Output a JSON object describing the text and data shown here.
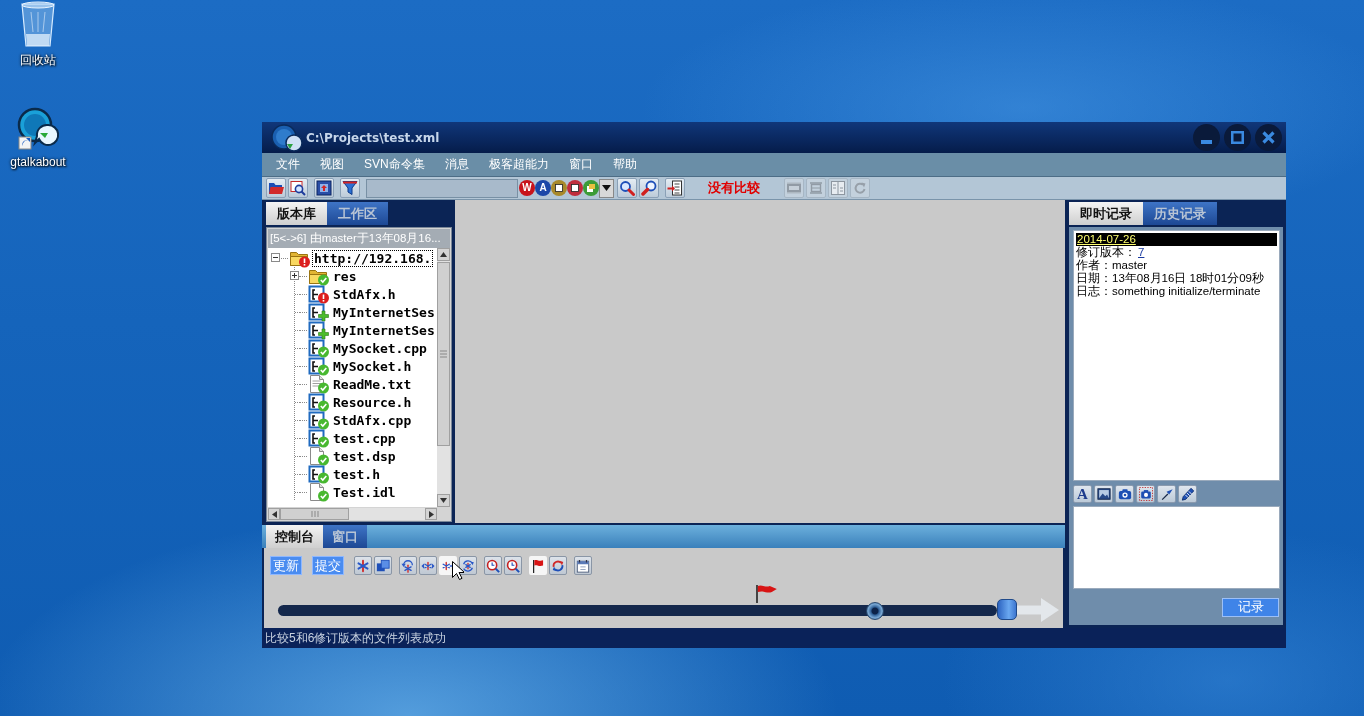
{
  "desktop": {
    "icons": [
      {
        "kind": "recycle-bin",
        "label": "回收站"
      },
      {
        "kind": "shortcut",
        "label": "gtalkabout"
      }
    ]
  },
  "window": {
    "title": "C:\\Projects\\test.xml"
  },
  "menu": [
    "文件",
    "视图",
    "SVN命令集",
    "消息",
    "极客超能力",
    "窗口",
    "帮助"
  ],
  "toolbar": {
    "tool_groups": [
      [
        {
          "kind": "folder",
          "disabled": false
        },
        {
          "kind": "find",
          "disabled": false
        }
      ],
      [
        {
          "kind": "monitor",
          "disabled": false
        }
      ],
      [
        {
          "kind": "funnel",
          "disabled": false
        }
      ]
    ],
    "filter_buttons": [
      {
        "kind": "letter",
        "label": "W",
        "color": "#c8141c"
      },
      {
        "kind": "letter",
        "label": "A",
        "color": "#1c48a8"
      },
      {
        "kind": "square",
        "color": "#a8892a"
      },
      {
        "kind": "square",
        "color": "#c02c3c"
      },
      {
        "kind": "window",
        "color": "#3c9c38"
      }
    ],
    "search_groups": [
      [
        {
          "kind": "zoom",
          "disabled": false
        },
        {
          "kind": "zoom-red",
          "disabled": false
        }
      ],
      [
        {
          "kind": "doc-arrow",
          "disabled": false
        }
      ]
    ],
    "compare_status": "没有比较",
    "compare_tools": [
      {
        "kind": "film",
        "disabled": true
      },
      {
        "kind": "frame",
        "disabled": true
      },
      {
        "kind": "compare",
        "disabled": true
      },
      {
        "kind": "refresh",
        "disabled": true
      }
    ]
  },
  "tree_panel": {
    "tabs": [
      {
        "label": "版本库",
        "selected": true
      },
      {
        "label": "工作区",
        "selected": false
      }
    ],
    "header": "[5<->6] 由master于13年08月16...",
    "root": {
      "label": "http://192.168.",
      "kind": "folder",
      "conflicted": true,
      "added": false,
      "expanded": true,
      "selected": true,
      "children": [
        {
          "label": "res",
          "kind": "folder",
          "conflicted": false,
          "added": false,
          "expanded": false,
          "selected": false
        },
        {
          "label": "StdAfx.h",
          "kind": "code",
          "conflicted": true,
          "added": false,
          "selected": false
        },
        {
          "label": "MyInternetSes",
          "kind": "code",
          "conflicted": false,
          "added": true,
          "selected": false
        },
        {
          "label": "MyInternetSes",
          "kind": "code",
          "conflicted": false,
          "added": true,
          "selected": false
        },
        {
          "label": "MySocket.cpp",
          "kind": "code",
          "conflicted": false,
          "added": false,
          "selected": false
        },
        {
          "label": "MySocket.h",
          "kind": "code",
          "conflicted": false,
          "added": false,
          "selected": false
        },
        {
          "label": "ReadMe.txt",
          "kind": "text",
          "conflicted": false,
          "added": false,
          "selected": false
        },
        {
          "label": "Resource.h",
          "kind": "code",
          "conflicted": false,
          "added": false,
          "selected": false
        },
        {
          "label": "StdAfx.cpp",
          "kind": "code",
          "conflicted": false,
          "added": false,
          "selected": false
        },
        {
          "label": "test.cpp",
          "kind": "code",
          "conflicted": false,
          "added": false,
          "selected": false
        },
        {
          "label": "test.dsp",
          "kind": "plain",
          "conflicted": false,
          "added": false,
          "selected": false
        },
        {
          "label": "test.h",
          "kind": "code",
          "conflicted": false,
          "added": false,
          "selected": false
        },
        {
          "label": "Test.idl",
          "kind": "plain",
          "conflicted": false,
          "added": false,
          "selected": false
        }
      ]
    }
  },
  "console": {
    "tabs": [
      {
        "label": "控制台",
        "selected": true
      },
      {
        "label": "窗口",
        "selected": false
      }
    ],
    "tool_groups": [
      [
        {
          "kind": "text",
          "label": "更新",
          "hovered": false
        }
      ],
      [
        {
          "kind": "text",
          "label": "提交",
          "hovered": false
        }
      ],
      [
        {
          "kind": "burst",
          "hovered": false
        },
        {
          "kind": "copy",
          "hovered": false
        }
      ],
      [
        {
          "kind": "burst-left",
          "hovered": false
        },
        {
          "kind": "burst-both",
          "hovered": false
        },
        {
          "kind": "burst-right",
          "hovered": true
        },
        {
          "kind": "burst-cycle",
          "hovered": false
        }
      ],
      [
        {
          "kind": "mag-clock",
          "hovered": false
        },
        {
          "kind": "mag-clock",
          "hovered": false
        }
      ],
      [
        {
          "kind": "flag",
          "hovered": true
        },
        {
          "kind": "sync",
          "hovered": false
        }
      ],
      [
        {
          "kind": "calendar",
          "hovered": false
        }
      ]
    ],
    "timeline": {
      "level": 0.83,
      "flag": {
        "level": 0.68
      }
    }
  },
  "log_panel": {
    "tabs": [
      {
        "label": "即时记录",
        "selected": true
      },
      {
        "label": "历史记录",
        "selected": false
      }
    ],
    "entry": {
      "date": "2014-07-26",
      "selected": true,
      "fields": [
        {
          "label": "修订版本：",
          "value": "7",
          "kind": "link"
        },
        {
          "label": "作者：",
          "value": "master",
          "kind": "text"
        },
        {
          "label": "日期：",
          "value": "13年08月16日 18时01分09秒",
          "kind": "text"
        },
        {
          "label": "日志：",
          "value": "something initialize/terminate",
          "kind": "text"
        }
      ]
    },
    "tools": [
      {
        "kind": "font",
        "label": "A"
      },
      {
        "kind": "image"
      },
      {
        "kind": "camera"
      },
      {
        "kind": "camera-select"
      },
      {
        "kind": "pin"
      },
      {
        "kind": "pencil"
      }
    ],
    "button": "记录"
  },
  "status_bar": "比较5和6修订版本的文件列表成功"
}
